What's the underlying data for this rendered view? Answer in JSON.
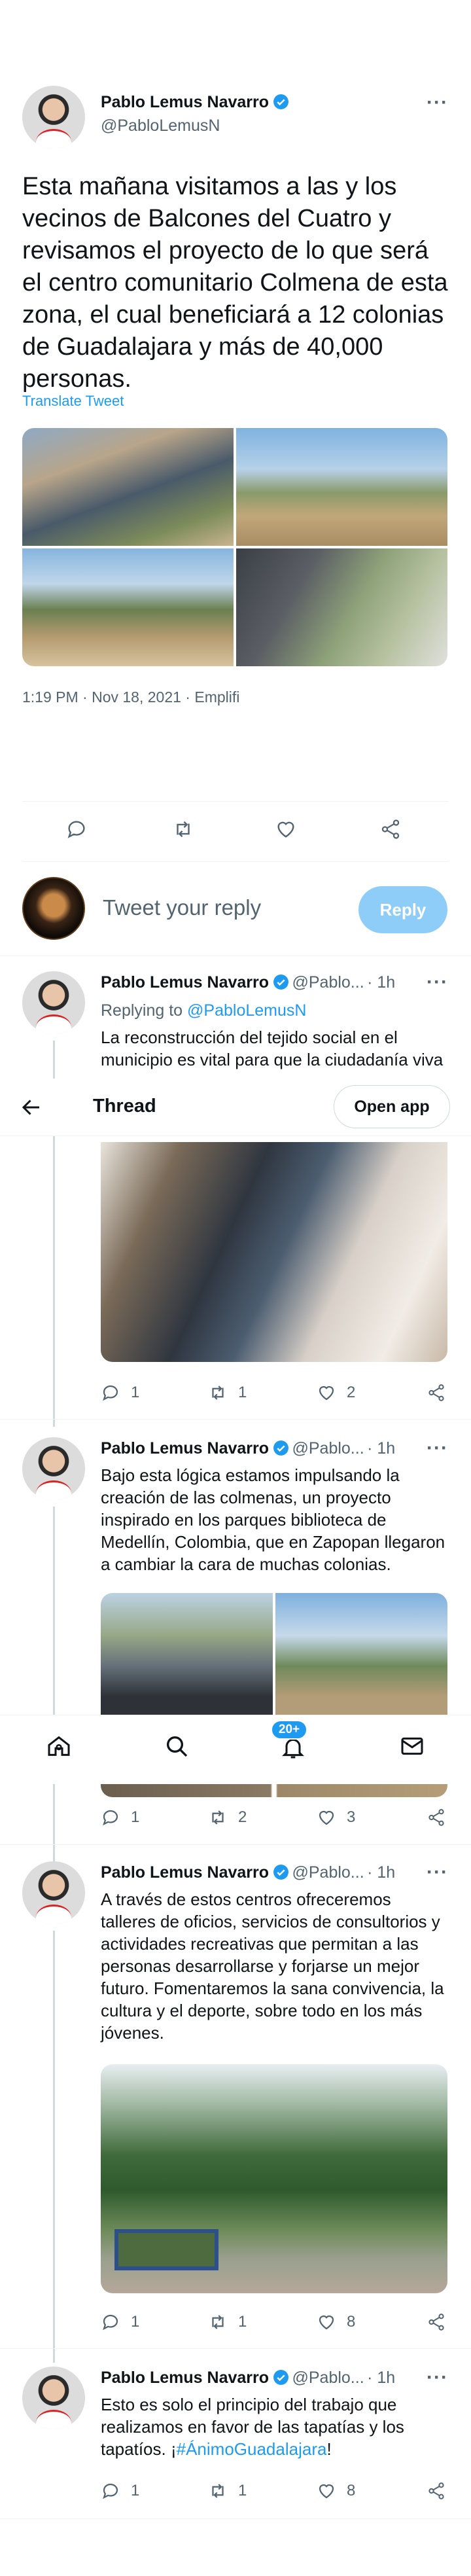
{
  "main_tweet": {
    "author_name": "Pablo Lemus Navarro",
    "author_handle": "@PabloLemusN",
    "text": "Esta mañana visitamos a las y los vecinos de Balcones del Cuatro y revisamos el proyecto de lo que será el centro comunitario Colmena de esta zona, el cual beneficiará a 12 colonias de Guadalajara y más de 40,000 personas.",
    "translate_label": "Translate Tweet",
    "timestamp": "1:19 PM · Nov 18, 2021 · Emplifi"
  },
  "reply_box": {
    "placeholder": "Tweet your reply",
    "reply_button": "Reply"
  },
  "thread_bar": {
    "title": "Thread",
    "open_app": "Open app"
  },
  "replies": [
    {
      "name": "Pablo Lemus Navarro",
      "handle": "@Pablo...",
      "time": "· 1h",
      "replying_prefix": "Replying to ",
      "replying_handle": "@PabloLemusN",
      "text": "La reconstrucción del tejido social en el municipio es vital para que la ciudadanía viva",
      "comments": "1",
      "retweets": "1",
      "likes": "2"
    },
    {
      "name": "Pablo Lemus Navarro",
      "handle": "@Pablo...",
      "time": "· 1h",
      "text": "Bajo esta lógica estamos impulsando la creación de las colmenas, un proyecto inspirado en los parques biblioteca de Medellín, Colombia, que en Zapopan llegaron a cambiar la cara de muchas colonias.",
      "comments": "1",
      "retweets": "2",
      "likes": "3"
    },
    {
      "name": "Pablo Lemus Navarro",
      "handle": "@Pablo...",
      "time": "· 1h",
      "text": "A través de estos centros ofreceremos talleres de oficios, servicios de consultorios y actividades recreativas que permitan a las personas desarrollarse y forjarse un mejor futuro. Fomentaremos la sana convivencia, la cultura y el deporte, sobre todo en los más jóvenes.",
      "comments": "1",
      "retweets": "1",
      "likes": "8"
    },
    {
      "name": "Pablo Lemus Navarro",
      "handle": "@Pablo...",
      "time": "· 1h",
      "text_before": "Esto es solo el principio del trabajo que realizamos en favor de las tapatías y los tapatíos. ¡",
      "hashtag": "#ÁnimoGuadalajara",
      "text_after": "!",
      "comments": "1",
      "retweets": "1",
      "likes": "8"
    }
  ],
  "bottom_nav": {
    "notifications_badge": "20+"
  },
  "colors": {
    "accent": "#1d9bf0",
    "reply_button_disabled": "#8ecdf8",
    "text": "#0f1419",
    "secondary": "#536471"
  }
}
